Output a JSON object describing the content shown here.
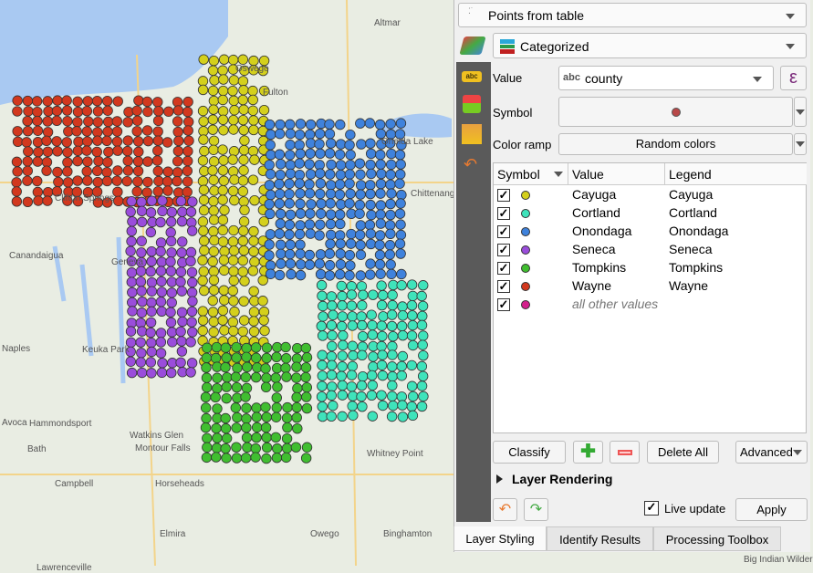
{
  "map": {
    "labels": [
      "Oswego",
      "Altmar",
      "Fulton",
      "Oneida Lake",
      "Chittenango",
      "Clifton Springs",
      "Canandaigua",
      "Geneva",
      "Naples",
      "Keuka Park",
      "Hammondsport",
      "Avoca",
      "Bath",
      "Watkins Glen",
      "Montour Falls",
      "Whitney Point",
      "Campbell",
      "Horseheads",
      "Elmira",
      "Owego",
      "Binghamton",
      "Lawrenceville",
      "Big Indian Wilderness"
    ],
    "colors": {
      "lake": "#a9c9f2",
      "land": "#e9ede3"
    }
  },
  "panel": {
    "layer_select": "Points from table",
    "renderer": "Categorized",
    "value_label": "Value",
    "value_field_type": "abc",
    "value_field": "county",
    "expression_icon": "ε",
    "symbol_label": "Symbol",
    "symbol_color": "#b84848",
    "color_ramp_label": "Color ramp",
    "color_ramp": "Random colors",
    "table": {
      "headers": [
        "Symbol",
        "Value",
        "Legend"
      ],
      "rows": [
        {
          "value": "Cayuga",
          "legend": "Cayuga",
          "color": "#d4d01c",
          "checked": true
        },
        {
          "value": "Cortland",
          "legend": "Cortland",
          "color": "#3fe3bb",
          "checked": true
        },
        {
          "value": "Onondaga",
          "legend": "Onondaga",
          "color": "#3f82dc",
          "checked": true
        },
        {
          "value": "Seneca",
          "legend": "Seneca",
          "color": "#9a4ddb",
          "checked": true
        },
        {
          "value": "Tompkins",
          "legend": "Tompkins",
          "color": "#40be30",
          "checked": true
        },
        {
          "value": "Wayne",
          "legend": "Wayne",
          "color": "#d2381e",
          "checked": true
        },
        {
          "value": "all other values",
          "legend": "",
          "color": "#d4208c",
          "checked": true
        }
      ]
    },
    "buttons": {
      "classify": "Classify",
      "delete_all": "Delete All",
      "advanced": "Advanced",
      "apply": "Apply"
    },
    "layer_rendering": "Layer Rendering",
    "live_update": "Live update",
    "live_update_checked": true,
    "tabs": [
      "Layer Styling",
      "Identify Results",
      "Processing Toolbox"
    ],
    "active_tab": "Layer Styling"
  }
}
